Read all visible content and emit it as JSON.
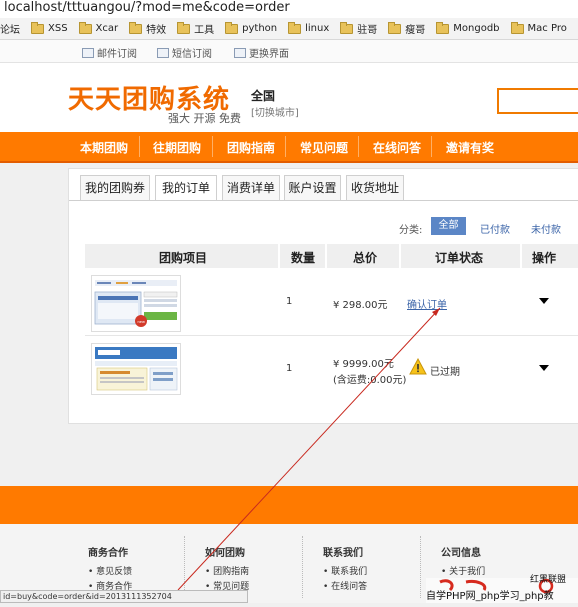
{
  "browser": {
    "url": "localhost/tttuangou/?mod=me&code=order",
    "bookmarks": [
      {
        "label": "论坛",
        "folder": false
      },
      {
        "label": "XSS",
        "folder": true
      },
      {
        "label": "Xcar",
        "folder": true
      },
      {
        "label": "特效",
        "folder": true
      },
      {
        "label": "工具",
        "folder": true
      },
      {
        "label": "python",
        "folder": true
      },
      {
        "label": "linux",
        "folder": true
      },
      {
        "label": "驻哥",
        "folder": true
      },
      {
        "label": "瘦哥",
        "folder": true
      },
      {
        "label": "Mongodb",
        "folder": true
      },
      {
        "label": "Mac Pro",
        "folder": true
      }
    ],
    "status_url": "id=buy&code=order&id=2013111352704"
  },
  "toplinks": {
    "mail": "邮件订阅",
    "sms": "短信订阅",
    "skin": "更换界面"
  },
  "header": {
    "logo": "天天团购系统",
    "slogan": "强大 开源 免费",
    "city": "全国",
    "switch_city": "[切换城市]"
  },
  "nav": [
    "本期团购",
    "往期团购",
    "团购指南",
    "常见问题",
    "在线问答",
    "邀请有奖"
  ],
  "tabs": [
    "我的团购券",
    "我的订单",
    "消费详单",
    "账户设置",
    "收货地址"
  ],
  "filter": {
    "label": "分类:",
    "all": "全部",
    "paid": "已付款",
    "unpaid": "未付款"
  },
  "table": {
    "headers": [
      "团购项目",
      "数量",
      "总价",
      "订单状态",
      "操作"
    ],
    "rows": [
      {
        "qty": "1",
        "price": "¥ 298.00元",
        "status": "确认订单",
        "expired": false
      },
      {
        "qty": "1",
        "price": "¥ 9999.00元",
        "price_note": "(含运费:0.00元)",
        "status": "已过期",
        "expired": true
      }
    ]
  },
  "footer": {
    "cols": [
      {
        "title": "商务合作",
        "items": [
          "意见反馈",
          "商务合作"
        ]
      },
      {
        "title": "如何团购",
        "items": [
          "团购指南",
          "常见问题"
        ]
      },
      {
        "title": "联系我们",
        "items": [
          "联系我们",
          "在线问答"
        ]
      },
      {
        "title": "公司信息",
        "items": [
          "关于我们",
          "隐私保护"
        ]
      }
    ]
  },
  "watermark": {
    "brand": "红黑联盟",
    "text": "自学PHP网_php学习_php教"
  },
  "colors": {
    "orange": "#ff7a00",
    "link_blue": "#3b64a8",
    "filter_active": "#5b86c6",
    "annotation_red": "#c8281e"
  }
}
